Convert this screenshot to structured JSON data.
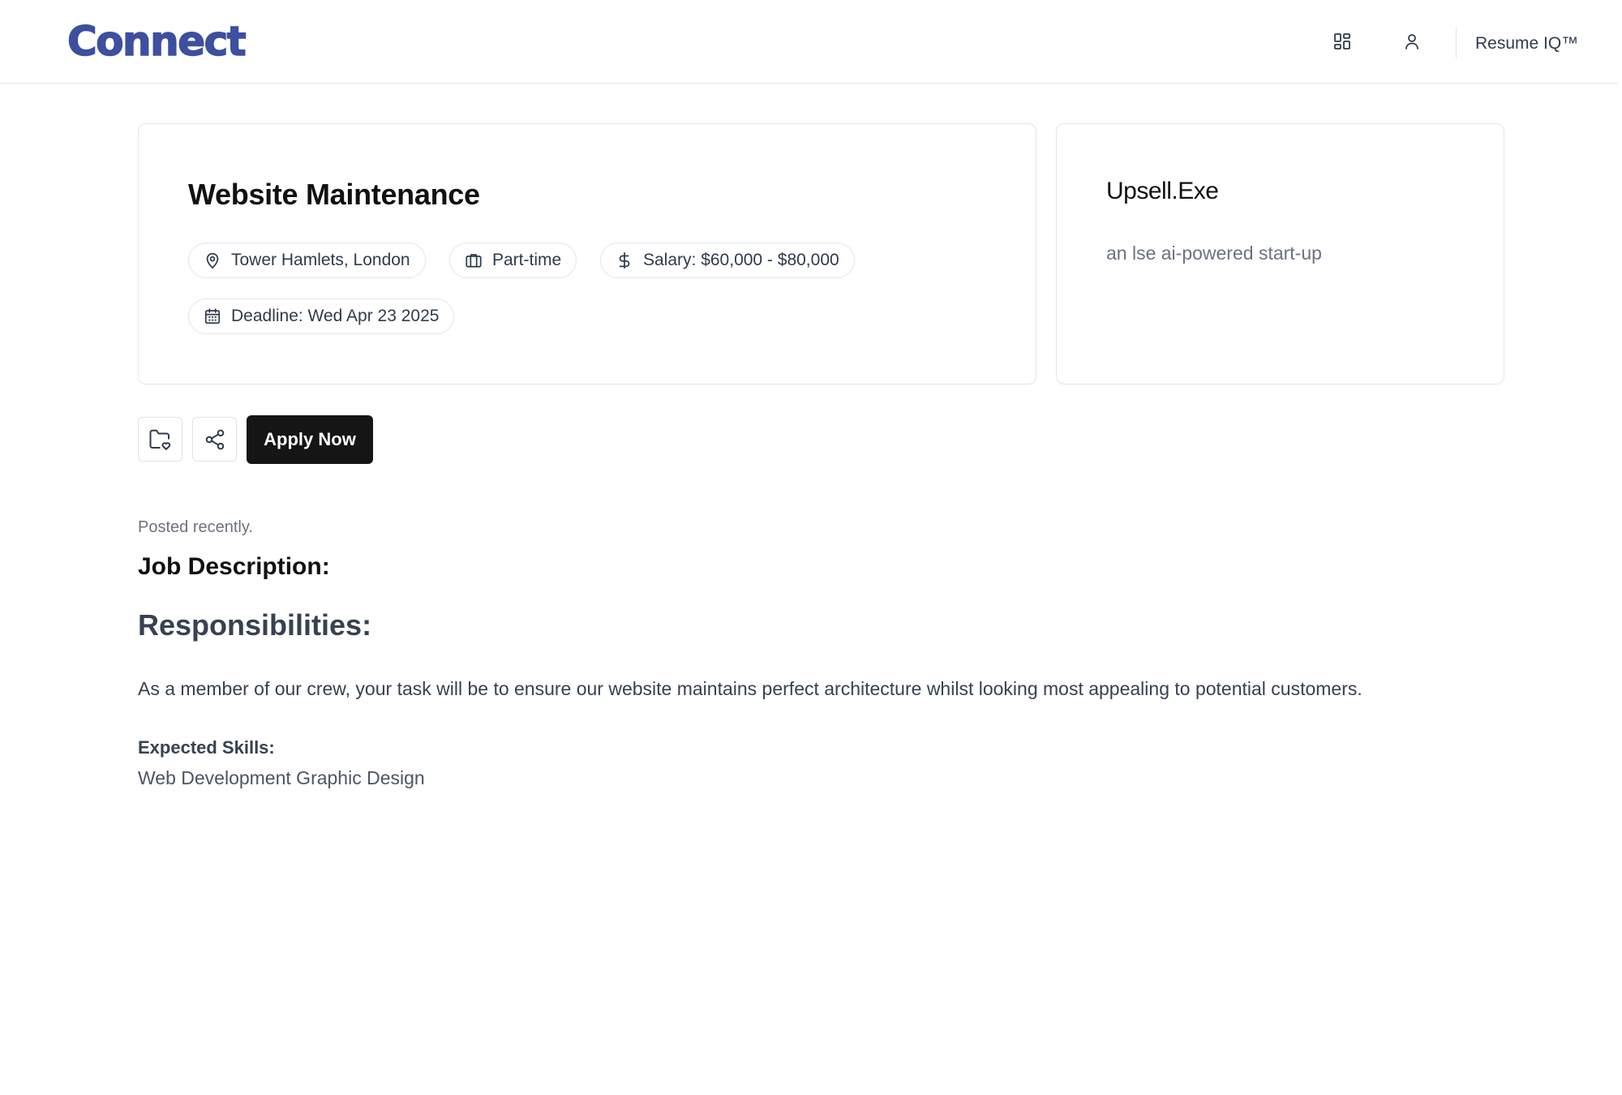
{
  "header": {
    "brand": "Connect",
    "nav_icons": [
      "dashboard-icon",
      "user-icon"
    ],
    "nav_link": "Resume IQ™"
  },
  "job": {
    "title": "Website Maintenance",
    "location": "Tower Hamlets, London",
    "type": "Part-time",
    "salary": "Salary: $60,000 - $80,000",
    "deadline": "Deadline: Wed Apr 23 2025"
  },
  "company": {
    "name": "Upsell.Exe",
    "tagline": "an lse ai-powered start-up"
  },
  "actions": {
    "save_icon": "folder-heart-icon",
    "share_icon": "share-icon",
    "apply_label": "Apply Now"
  },
  "details": {
    "posted": "Posted recently.",
    "description_heading": "Job Description:",
    "responsibilities_heading": "Responsibilities:",
    "responsibilities_text": "As a member of our crew, your task will be to ensure our website maintains perfect architecture whilst looking most appealing to potential customers.",
    "skills_label": "Expected Skills:",
    "skills": "Web Development Graphic Design"
  },
  "colors": {
    "brand": "#3d4f9f",
    "primary_button": "#151515",
    "border": "#e3e5e8",
    "muted_text": "#6b7280"
  }
}
